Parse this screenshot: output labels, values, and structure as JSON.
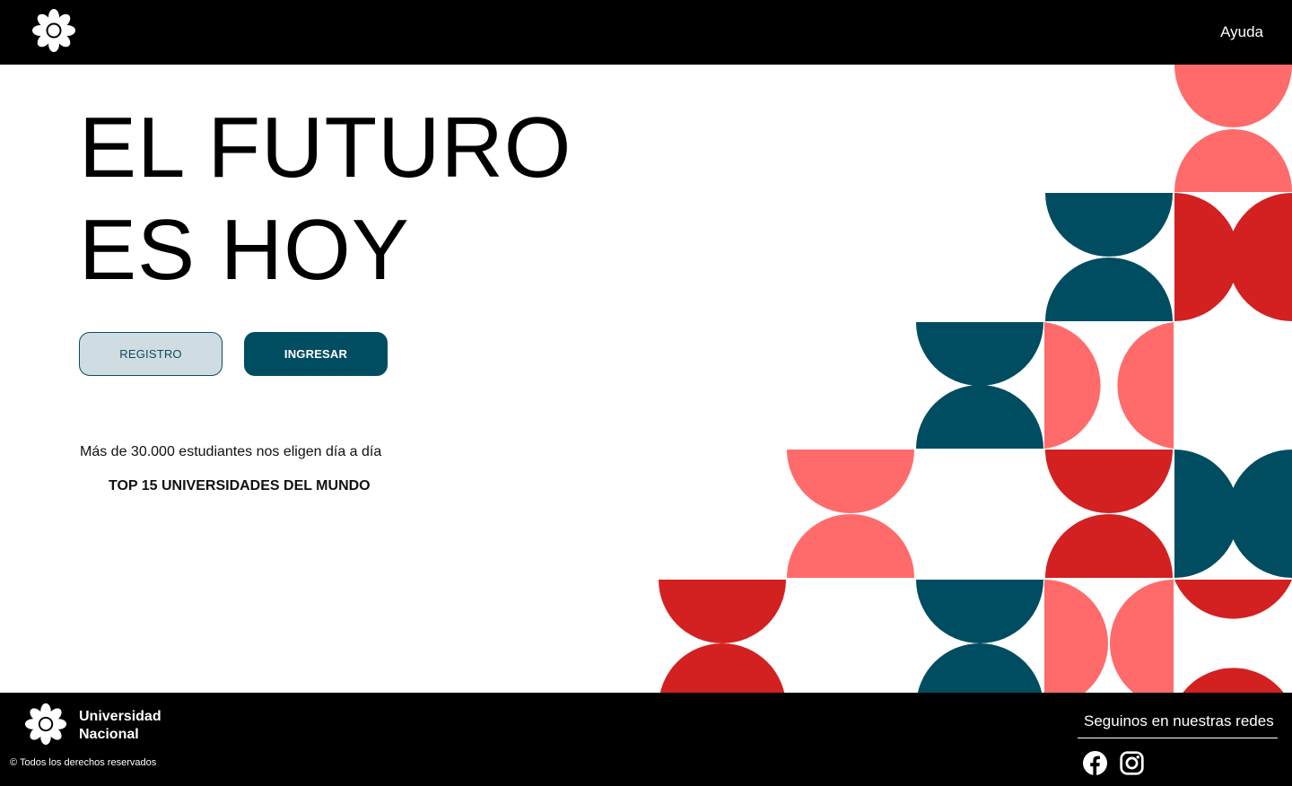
{
  "header": {
    "logo_icon": "flower-logo-icon",
    "help_label": "Ayuda"
  },
  "hero": {
    "title_line1": "EL FUTURO",
    "title_line2": "ES HOY",
    "register_label": "REGISTRO",
    "login_label": "INGRESAR",
    "stat_text": "Más de 30.000 estudiantes nos eligen día a día",
    "ranking_text": "TOP 15 UNIVERSIDADES DEL MUNDO"
  },
  "colors": {
    "salmon": "#ff6b6b",
    "red": "#d32020",
    "teal": "#004d61",
    "black": "#000000",
    "register_bg": "#cfdce1"
  },
  "footer": {
    "logo_icon": "flower-logo-icon",
    "name_line1": "Universidad",
    "name_line2": "Nacional",
    "rights": "© Todos los derechos reservados",
    "follow_label": "Seguinos en nuestras redes",
    "social": [
      "facebook-icon",
      "instagram-icon"
    ]
  }
}
